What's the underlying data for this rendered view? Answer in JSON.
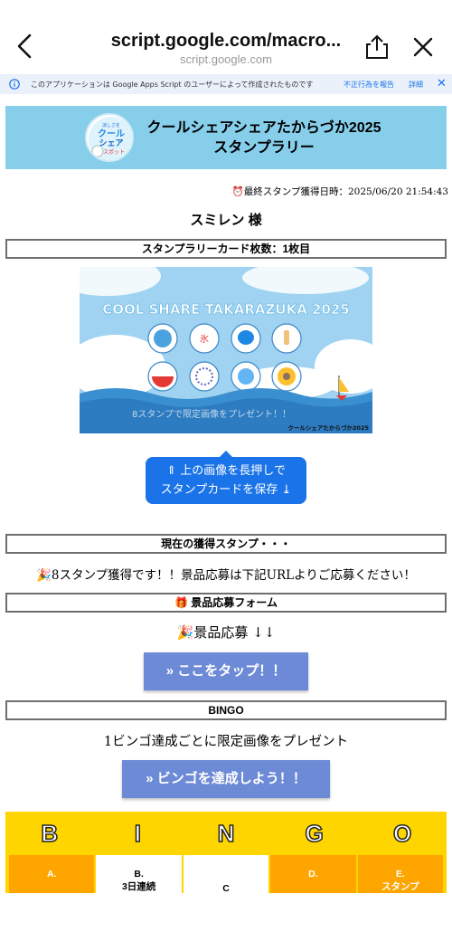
{
  "browser": {
    "title": "script.google.com/macro...",
    "subtitle": "script.google.com"
  },
  "gas_banner": {
    "text": "このアプリケーションは Google Apps Script のユーザーによって作成されたものです",
    "report": "不正行為を報告",
    "details": "詳細"
  },
  "header": {
    "title_line1": "クールシェアシェアたからづか2025",
    "title_line2": "スタンプラリー",
    "logo_text": [
      "涼しさを",
      "クール",
      "シェア",
      "スポット"
    ]
  },
  "last_stamp": "⏰最終スタンプ獲得日時：2025/06/20 21:54:43",
  "user_name": "スミレン 様",
  "card_count_label": "スタンプラリーカード枚数：1枚目",
  "card": {
    "title": "COOL SHARE TAKARAZUKA 2025",
    "caption": "8スタンプで限定画像をプレゼント！！",
    "brand": "クールシェアたからづか2025",
    "stamps": [
      "氷",
      "かき氷",
      "うちわ",
      "アイス",
      "すいか",
      "花火",
      "風鈴",
      "ひまわり"
    ]
  },
  "save_button": {
    "line1": "上の画像を長押しで",
    "line2": "スタンプカードを保存"
  },
  "current_stamp_label": "現在の獲得スタンプ・・・",
  "stamp_message": "🎉8スタンプ獲得です！！景品応募は下記URLよりご応募ください！",
  "prize_form_label": "🎁 景品応募フォーム",
  "prize_text": "🎉景品応募 ↓↓",
  "tap_button": "» ここをタップ！！",
  "bingo_label": "BINGO",
  "bingo_desc": "1ビンゴ達成ごとに限定画像をプレゼント",
  "bingo_button": "» ビンゴを達成しよう！！",
  "bingo": {
    "letters": [
      "B",
      "I",
      "N",
      "G",
      "O"
    ],
    "row1": [
      "A.",
      "B.\n3日連続",
      "C",
      "D.",
      "E.\nスタンプ"
    ]
  },
  "colors": {
    "header_bg": "#87ceeb",
    "save_button": "#1a73e8",
    "cta_button": "#6c8ad6",
    "bingo_bg": "#ffd500",
    "bingo_orange": "#ffa500"
  }
}
